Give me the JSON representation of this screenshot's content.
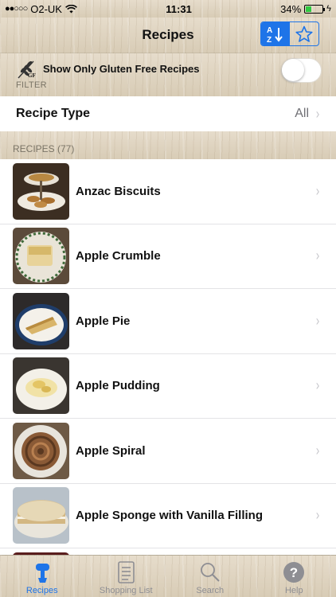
{
  "status_bar": {
    "carrier": "O2-UK",
    "time": "11:31",
    "battery": "34%",
    "battery_level": 0.34
  },
  "nav": {
    "title": "Recipes",
    "sort_icon": "az-sort-icon",
    "favorites_icon": "star-icon"
  },
  "filter": {
    "gluten_label": "Show Only Gluten Free Recipes",
    "gluten_icon_text": "GF",
    "caption": "FILTER",
    "gluten_enabled": false
  },
  "recipe_type": {
    "label": "Recipe Type",
    "value": "All"
  },
  "recipes": {
    "header": "RECIPES (77)",
    "items": [
      {
        "title": "Anzac Biscuits"
      },
      {
        "title": "Apple Crumble"
      },
      {
        "title": "Apple Pie"
      },
      {
        "title": "Apple Pudding"
      },
      {
        "title": "Apple Spiral"
      },
      {
        "title": "Apple Sponge with Vanilla Filling"
      }
    ]
  },
  "tabs": [
    {
      "label": "Recipes",
      "icon": "mixer-icon",
      "active": true
    },
    {
      "label": "Shopping List",
      "icon": "list-icon",
      "active": false
    },
    {
      "label": "Search",
      "icon": "search-icon",
      "active": false
    },
    {
      "label": "Help",
      "icon": "help-icon",
      "active": false
    }
  ],
  "colors": {
    "accent": "#1e74e8",
    "battery": "#2fc940"
  }
}
